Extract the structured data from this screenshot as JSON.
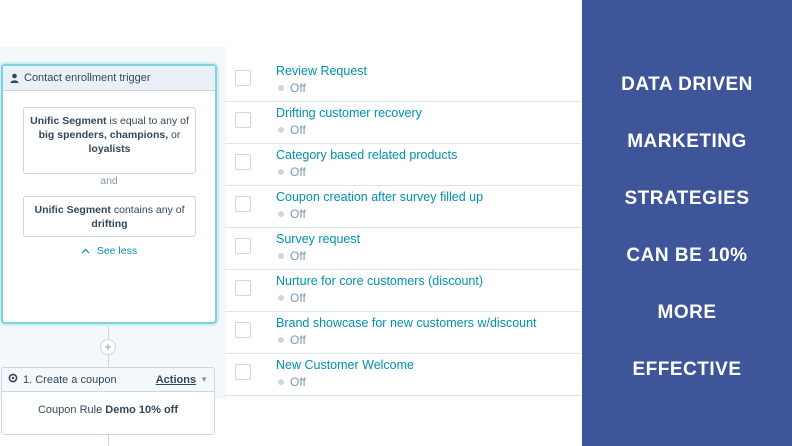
{
  "workflow": {
    "trigger": {
      "title": "Contact enrollment trigger",
      "icon": "user-icon",
      "condition1": {
        "prop": "Unific Segment",
        "text1": " is equal to any of ",
        "values": "big spenders, champions,",
        "text2": " or ",
        "last": "loyalists"
      },
      "and_label": "and",
      "condition2": {
        "prop": "Unific Segment",
        "text1": " contains any of ",
        "value": "drifting"
      },
      "see_less": "See less"
    },
    "plus": "+",
    "action": {
      "icon": "gear-icon",
      "title": "1. Create a coupon",
      "actions_label": "Actions",
      "body_prefix": "Coupon Rule ",
      "body_value": "Demo 10% off"
    }
  },
  "list": {
    "items": [
      {
        "name": "Review Request",
        "status": "Off"
      },
      {
        "name": "Drifting customer recovery",
        "status": "Off"
      },
      {
        "name": "Category based related products",
        "status": "Off"
      },
      {
        "name": "Coupon creation after survey filled up",
        "status": "Off"
      },
      {
        "name": "Survey request",
        "status": "Off"
      },
      {
        "name": "Nurture for core customers (discount)",
        "status": "Off"
      },
      {
        "name": "Brand showcase for new customers w/discount",
        "status": "Off"
      },
      {
        "name": "New Customer Welcome",
        "status": "Off"
      }
    ]
  },
  "promo": {
    "lines": [
      "DATA DRIVEN",
      "MARKETING",
      "STRATEGIES",
      "CAN BE 10%",
      "MORE",
      "EFFECTIVE"
    ],
    "background": "#3e5699"
  }
}
